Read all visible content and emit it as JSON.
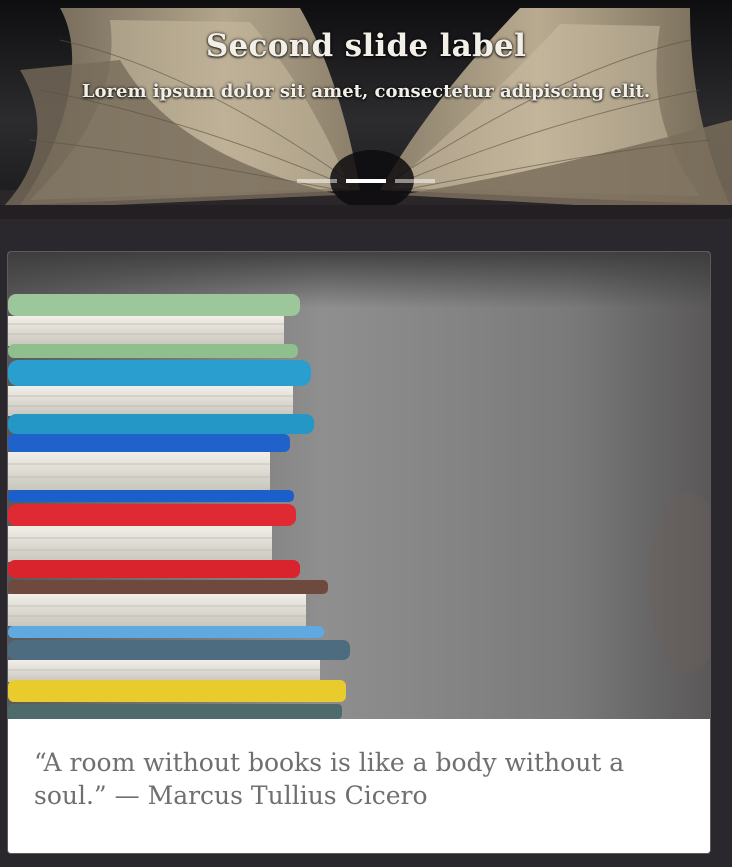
{
  "carousel": {
    "title": "Second slide label",
    "text": "Lorem ipsum dolor sit amet, consectetur adipiscing elit.",
    "slides": [
      {
        "active": false
      },
      {
        "active": true
      },
      {
        "active": false
      }
    ]
  },
  "card": {
    "quote": "“A room without books is like a body without a soul.” — Marcus Tullius Cicero"
  },
  "colors": {
    "page_background": "#2a272d",
    "card_background": "#ffffff",
    "quote_text": "#6f6f6f",
    "caption_text": "#f2efe9"
  }
}
